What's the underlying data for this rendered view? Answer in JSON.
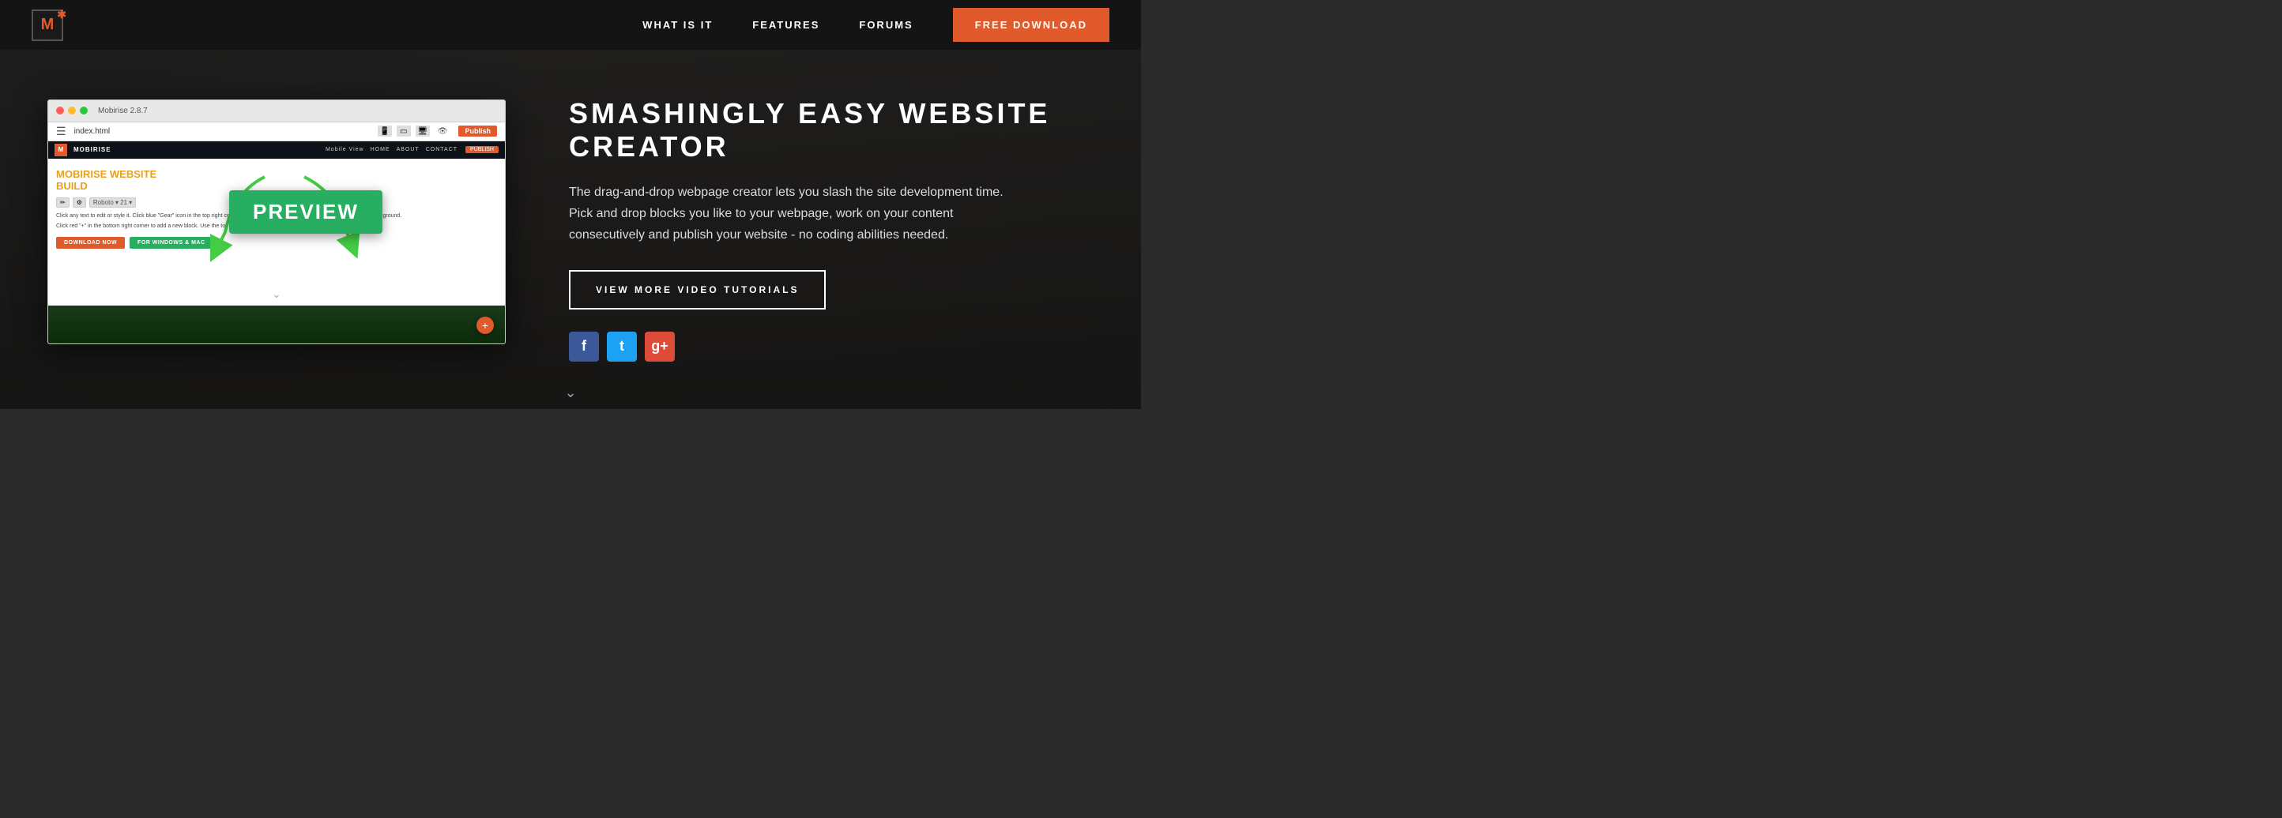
{
  "nav": {
    "logo_letter": "M",
    "what_is_it": "WHAT IS IT",
    "features": "FEATURES",
    "forums": "FORUMS",
    "free_download": "FREE DOWNLOAD"
  },
  "app_window": {
    "title": "Mobirise 2.8.7",
    "address": "index.html",
    "publish": "Publish"
  },
  "inner_site": {
    "brand": "MOBIRISE",
    "nav_label": "Mobile View",
    "nav_home": "HOME",
    "nav_about": "ABOUT",
    "nav_contact": "CONTACT",
    "inner_publish": "PUBLISH",
    "heading_line1": "MOBIRISE WEBSITE",
    "heading_line2": "BUILD",
    "body_text1": "Click any text to edit or style it. Click blue \"Gear\" icon in the top right corner to hide/show buttons, text, title and change the block background.",
    "body_text2": "Click red \"+\" in the bottom right corner to add a new block. Use the top left menu to create new pages, sites and add extensions.",
    "btn_download": "DOWNLOAD NOW",
    "btn_windows": "FOR WINDOWS & MAC"
  },
  "preview_label": "PREVIEW",
  "right": {
    "heading_line1": "SMASHINGLY EASY WEBSITE",
    "heading_line2": "CREATOR",
    "description": "The drag-and-drop webpage creator lets you slash the site development time. Pick and drop blocks you like to your webpage, work on your content consecutively and publish your website - no coding abilities needed.",
    "video_btn": "VIEW MORE VIDEO TUTORIALS",
    "social_facebook": "f",
    "social_twitter": "t",
    "social_google": "g+"
  },
  "platforms": "For Windows Mac",
  "scroll_arrow": "❯"
}
